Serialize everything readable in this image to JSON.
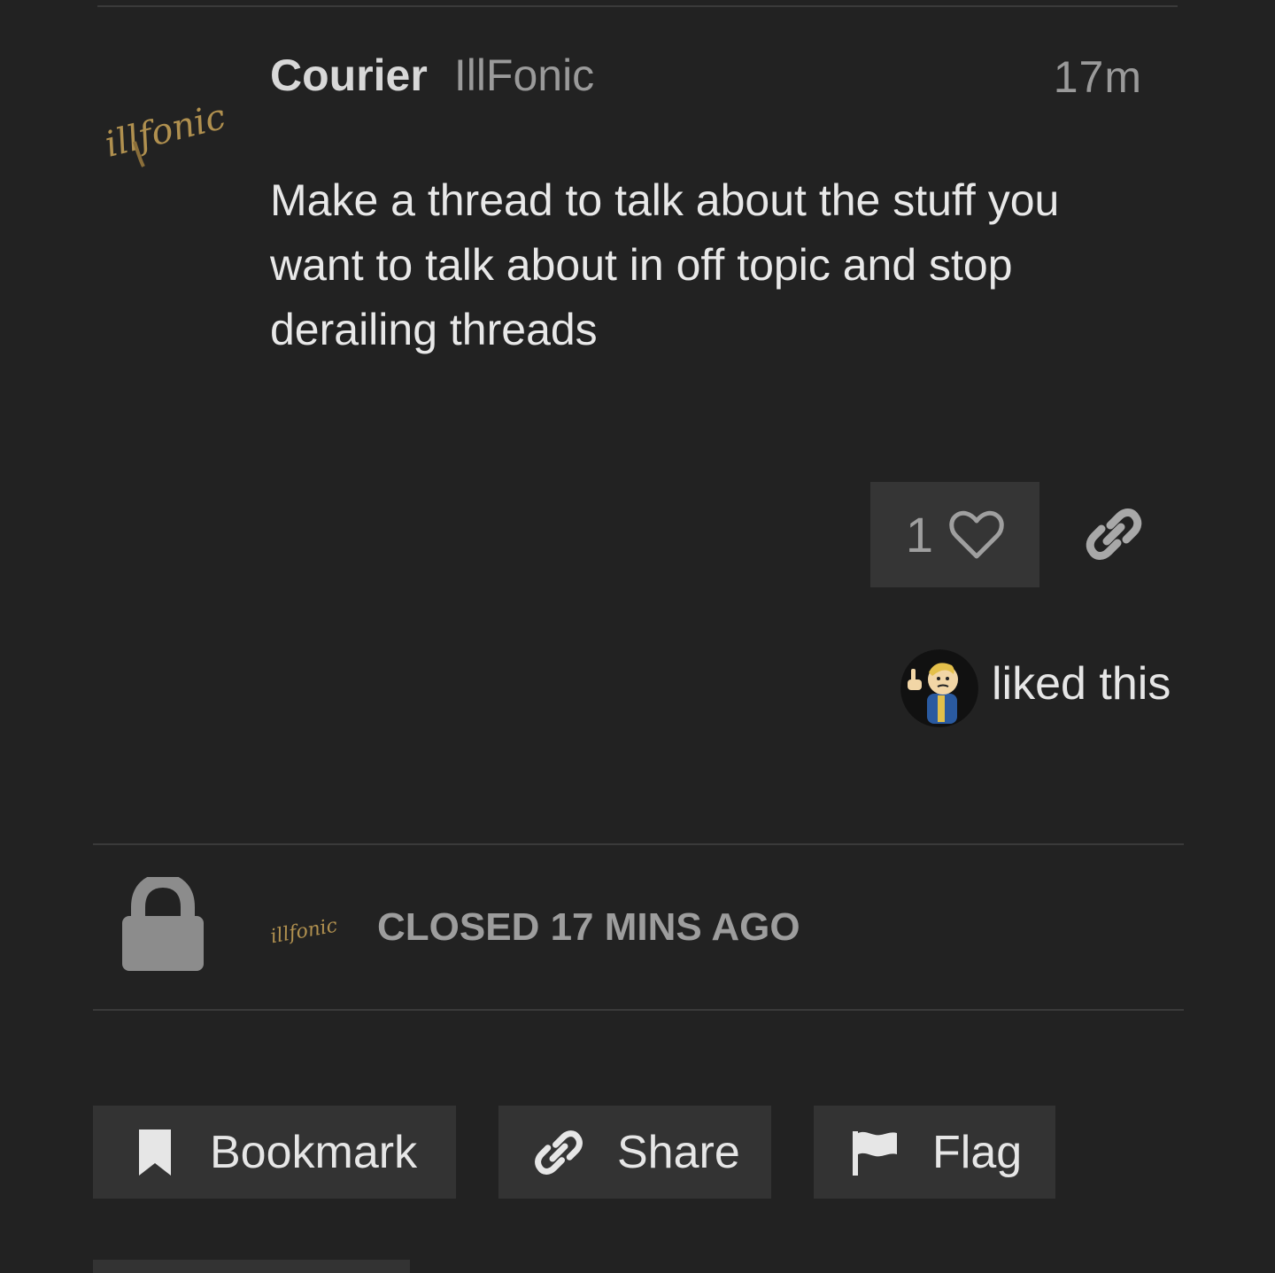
{
  "post": {
    "author": "Courier",
    "author_title": "IllFonic",
    "time": "17m",
    "body": "Make a thread to talk about the stuff you want to talk about in off topic and stop derailing threads",
    "avatar_icon": "illfonic-logo",
    "avatar_logo_text": "illfonic"
  },
  "actions": {
    "like_count": "1",
    "like_icon": "heart-icon",
    "link_icon": "link-icon"
  },
  "likes": {
    "liker_avatar_icon": "vault-boy-avatar",
    "text": "liked this"
  },
  "closed": {
    "icon": "lock-icon",
    "text": "CLOSED 17 MINS AGO"
  },
  "footer_buttons": {
    "bookmark": {
      "label": "Bookmark",
      "icon": "bookmark-icon"
    },
    "share": {
      "label": "Share",
      "icon": "link-icon"
    },
    "flag": {
      "label": "Flag",
      "icon": "flag-icon"
    }
  },
  "colors": {
    "background": "#222222",
    "button_bg": "#333333",
    "muted_text": "#9a9a9a",
    "logo_gold": "#b0904f"
  }
}
